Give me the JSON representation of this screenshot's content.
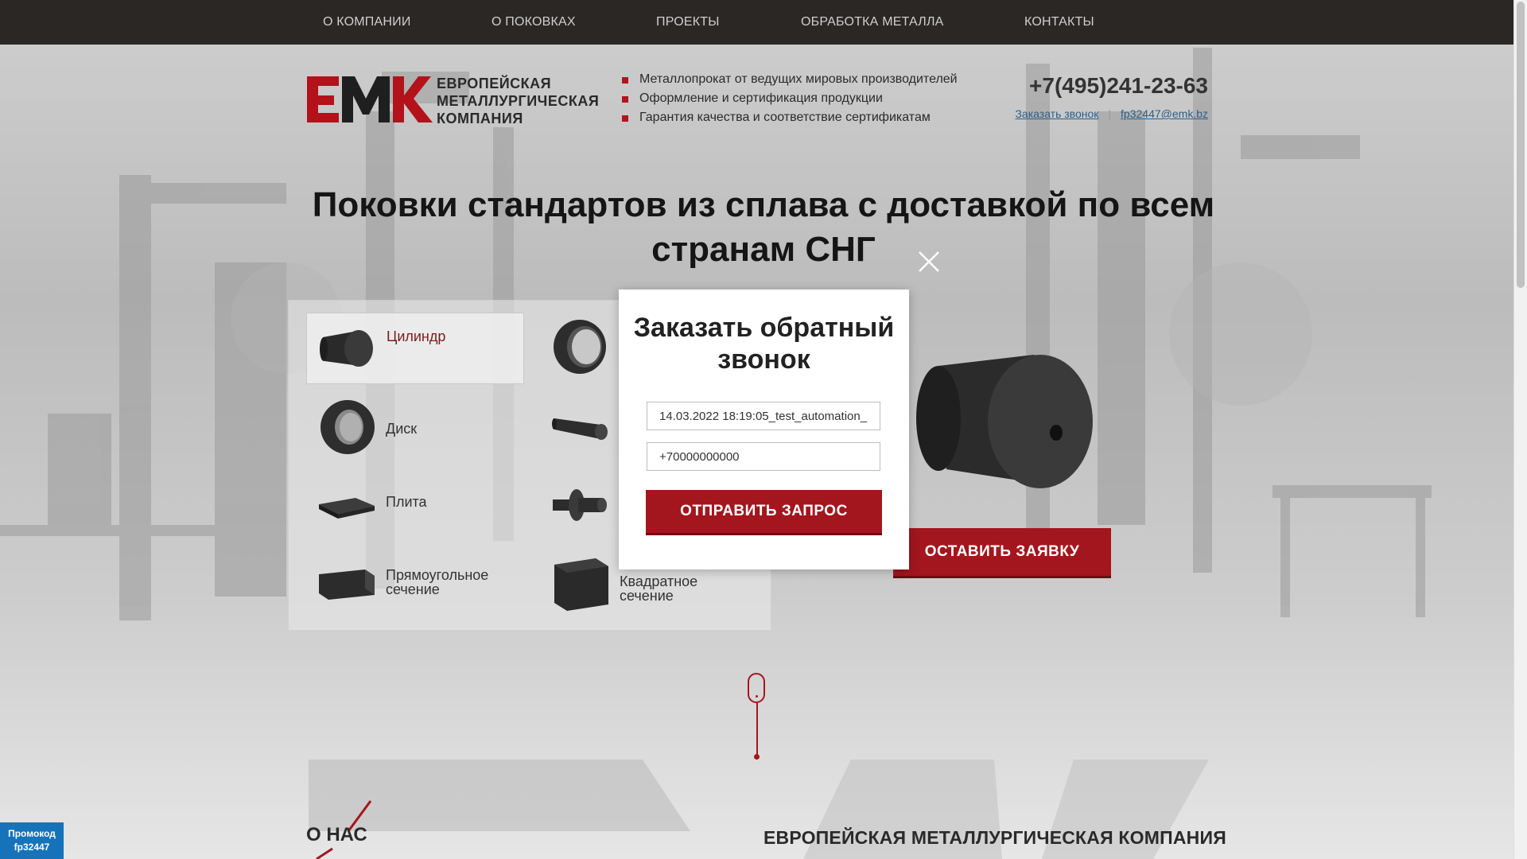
{
  "nav": {
    "items": [
      "О КОМПАНИИ",
      "О ПОКОВКАХ",
      "ПРОЕКТЫ",
      "ОБРАБОТКА МЕТАЛЛА",
      "КОНТАКТЫ"
    ]
  },
  "header": {
    "logo_lines": [
      "ЕВРОПЕЙСКАЯ",
      "МЕТАЛЛУРГИЧЕСКАЯ",
      "КОМПАНИЯ"
    ],
    "bullets": [
      "Металлопрокат от ведущих мировых производителей",
      "Оформление и сертификация продукции",
      "Гарантия качества и соответствие сертификатам"
    ],
    "phone": "+7(495)241-23-63",
    "callback_link": "Заказать звонок",
    "email": "fp32447@emk.bz"
  },
  "hero": {
    "title": "Поковки стандартов из сплава с доставкой по всем странам СНГ",
    "apply_button": "ОСТАВИТЬ ЗАЯВКУ"
  },
  "catalog": {
    "items": [
      {
        "label": "Цилиндр",
        "icon": "cylinder-icon"
      },
      {
        "label": "Диск",
        "icon": "disk-icon"
      },
      {
        "label": "Плита",
        "icon": "plate-icon"
      },
      {
        "label": "Прямоугольное сечение",
        "icon": "rect-section-icon"
      },
      {
        "label": "",
        "icon": "ring-icon"
      },
      {
        "label": "",
        "icon": "rod-icon"
      },
      {
        "label": "",
        "icon": "shaft-icon"
      },
      {
        "label": "Квадратное сечение",
        "icon": "square-section-icon"
      }
    ]
  },
  "about": {
    "left_title": "О НАС",
    "right_title": "ЕВРОПЕЙСКАЯ МЕТАЛЛУРГИЧЕСКАЯ КОМПАНИЯ"
  },
  "promo": {
    "line1": "Промокод",
    "line2": "fp32447"
  },
  "modal": {
    "title": "Заказать обратный звонок",
    "name_value": "14.03.2022 18:19:05_test_automation_",
    "phone_value": "+70000000000",
    "submit": "ОТПРАВИТЬ ЗАПРОС"
  },
  "colors": {
    "accent": "#a3161e",
    "nav_bg": "#2a2725",
    "link": "#2c5f8a",
    "promo_bg": "#1673b9"
  }
}
